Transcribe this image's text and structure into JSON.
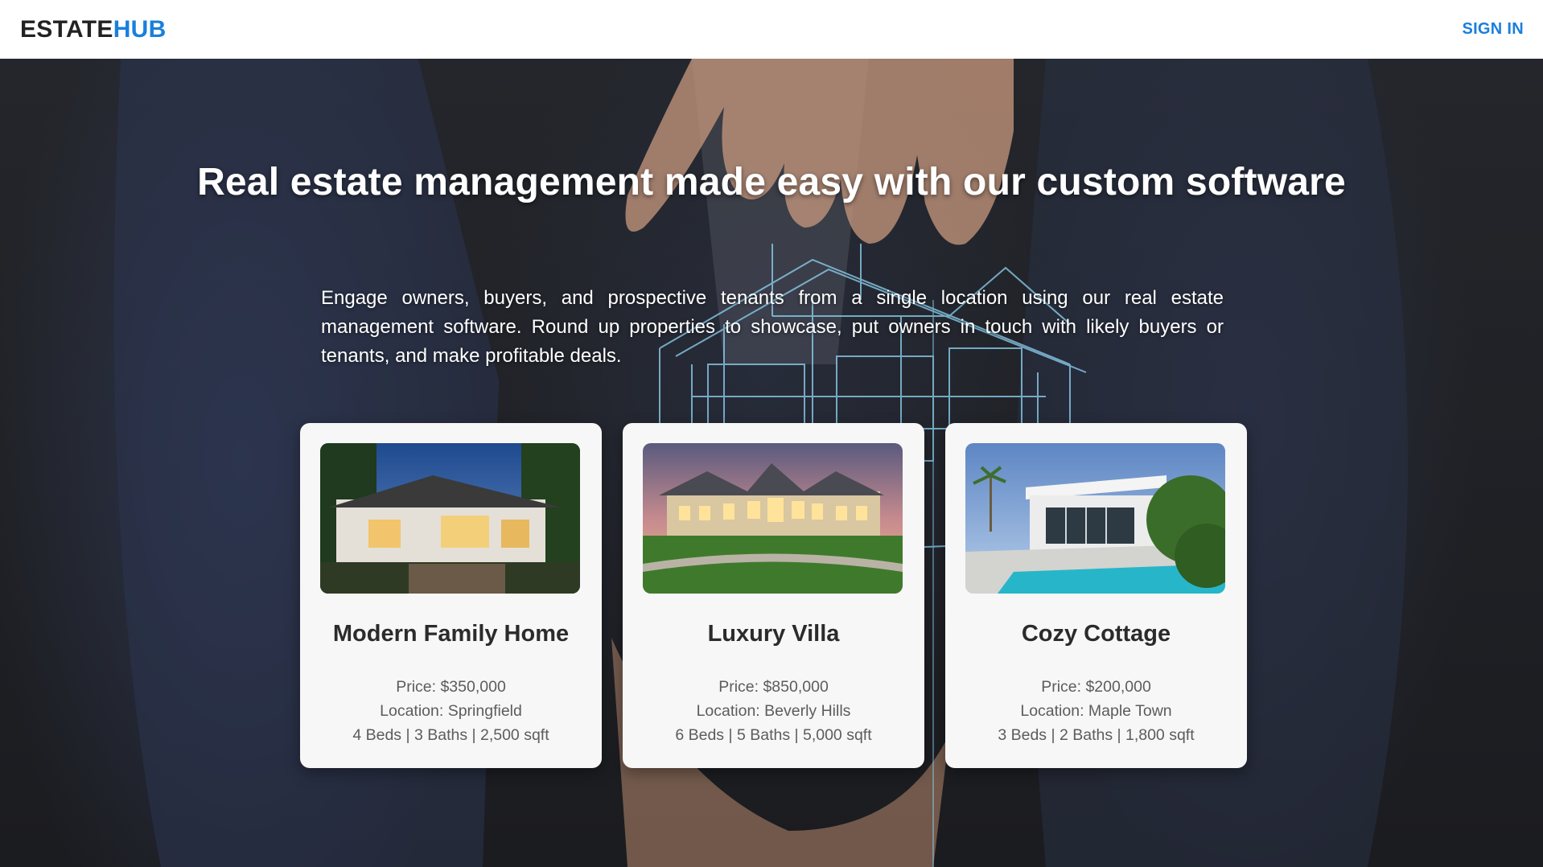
{
  "nav": {
    "logo_part1": "ESTATE",
    "logo_part2": "HUB",
    "signin_label": "SIGN IN"
  },
  "hero": {
    "headline": "Real estate management made easy with our custom software",
    "intro": "Engage owners, buyers, and prospective tenants from a single location using our real estate management software. Round up properties to showcase, put owners in touch with likely buyers or tenants, and make profitable deals."
  },
  "properties": [
    {
      "title": "Modern Family Home",
      "price": "Price: $350,000",
      "location": "Location: Springfield",
      "specs": "4 Beds | 3 Baths | 2,500 sqft"
    },
    {
      "title": "Luxury Villa",
      "price": "Price: $850,000",
      "location": "Location: Beverly Hills",
      "specs": "6 Beds | 5 Baths | 5,000 sqft"
    },
    {
      "title": "Cozy Cottage",
      "price": "Price: $200,000",
      "location": "Location: Maple Town",
      "specs": "3 Beds | 2 Baths | 1,800 sqft"
    }
  ],
  "colors": {
    "accent": "#1a7fdc",
    "nav_bg": "#ffffff",
    "card_bg": "#f7f7f7"
  }
}
